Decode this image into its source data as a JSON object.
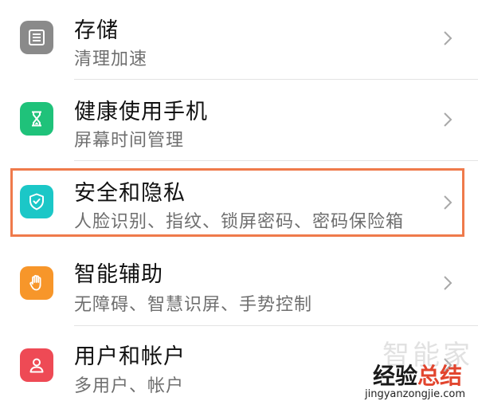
{
  "settings": {
    "items": [
      {
        "title": "存储",
        "subtitle": "清理加速",
        "icon": "storage-icon",
        "icon_color": "#8a8a8a"
      },
      {
        "title": "健康使用手机",
        "subtitle": "屏幕时间管理",
        "icon": "hourglass-icon",
        "icon_color": "#1fc27a"
      },
      {
        "title": "安全和隐私",
        "subtitle": "人脸识别、指纹、锁屏密码、密码保险箱",
        "icon": "shield-icon",
        "icon_color": "#1bc7c7"
      },
      {
        "title": "智能辅助",
        "subtitle": "无障碍、智慧识屏、手势控制",
        "icon": "hand-icon",
        "icon_color": "#f7962a"
      },
      {
        "title": "用户和帐户",
        "subtitle": "多用户、帐户",
        "icon": "user-icon",
        "icon_color": "#ee4a55"
      }
    ],
    "highlight_color": "#ef7a4b"
  },
  "watermark": {
    "faint_text": "智能家",
    "brand_part1": "经验",
    "brand_part2": "总结",
    "url": "jingyanzongjie.com"
  }
}
